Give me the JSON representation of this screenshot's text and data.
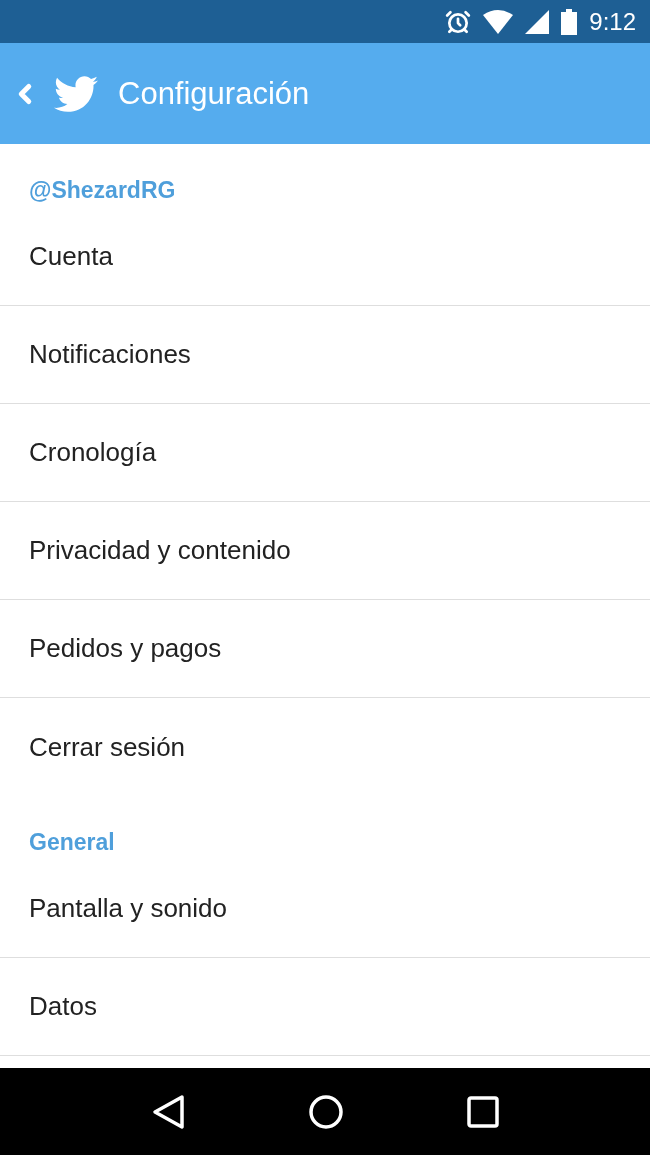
{
  "status_bar": {
    "time": "9:12"
  },
  "app_bar": {
    "title": "Configuración"
  },
  "sections": [
    {
      "header": "@ShezardRG",
      "items": [
        {
          "label": "Cuenta"
        },
        {
          "label": "Notificaciones"
        },
        {
          "label": "Cronología"
        },
        {
          "label": "Privacidad y contenido"
        },
        {
          "label": "Pedidos y pagos"
        },
        {
          "label": "Cerrar sesión"
        }
      ]
    },
    {
      "header": "General",
      "items": [
        {
          "label": "Pantalla y sonido"
        },
        {
          "label": "Datos"
        }
      ]
    }
  ]
}
